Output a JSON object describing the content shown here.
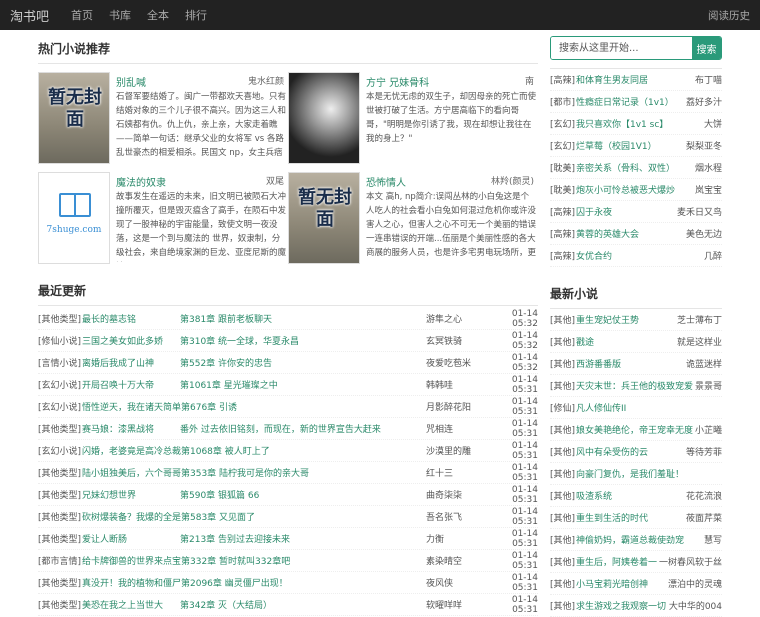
{
  "nav": {
    "brand": "淘书吧",
    "items": [
      "首页",
      "书库",
      "全本",
      "排行"
    ],
    "history": "阅读历史"
  },
  "hot": {
    "title": "热门小说推荐",
    "items": [
      {
        "title": "别乱喊",
        "author": "鬼水红颜",
        "cover": "placeholder",
        "cover_text": "暂无封面",
        "desc": "石督军要结婚了。闽广一带都欢天喜地。只有结婚对象的三个儿子很不高兴。因为这三人和石姨都有仇。仇上仇，亲上亲，大家走着瞧——简单一句话：继承父业的女将军 vs 各路乱世豪杰的相爱相杀。民国文 np，女主兵痞"
      },
      {
        "title": "方宁 兄妹骨科",
        "author": "南",
        "cover": "photo",
        "desc": "本是无忧无虑的双生子，却因母亲的死亡而使世被打破了生活。方宁居高临下的看向哥哥，\"明明是你引诱了我，现在却想让我往在我的身上？\""
      },
      {
        "title": "魔法的奴隶",
        "author": "双尾",
        "cover": "logo",
        "cover_text": "7shuge.com",
        "desc": "故事发生在遥远的未来，旧文明已被陨石大冲撞所覆灭，但是毁灭瘟含了高手，在陨石中发现了一股神秘的宇宙能量，致使文明一夜没落，这是一个到与魔法的 世界，奴隶制，分级社会，来自绝境家渊的巨龙、亚度尼斯的魔法"
      },
      {
        "title": "恐怖情人",
        "author": "林羚(颜灵)",
        "cover": "placeholder",
        "cover_text": "暂无封面",
        "desc": "本文 高h, np简介:误闯丛林的小白兔这是个人吃人的社会看小白兔如何混过危机你或许没害人之心，但害人之心不可无一个美丽的错误一连串错误的开端...伍丽是个美丽性感的各大商展的服务人员，也是许多宅男电玩场所，更"
      }
    ]
  },
  "updates": {
    "title": "最近更新",
    "rows": [
      {
        "cat": "[其他类型]",
        "book": "最长的墓志铭",
        "chapter": "第381章 跟前老板聊天",
        "author": "游隼之心",
        "time": "01-14 05:32"
      },
      {
        "cat": "[修仙小说]",
        "book": "三国之美女如此多娇",
        "chapter": "第310章 统一全球，华夏永昌",
        "author": "玄冥铁骑",
        "time": "01-14 05:32"
      },
      {
        "cat": "[言情小说]",
        "book": "离婚后我成了山神",
        "chapter": "第552章 许你安的忠告",
        "author": "夜爱吃苞米",
        "time": "01-14 05:32"
      },
      {
        "cat": "[玄幻小说]",
        "book": "开局召唤十万大帝",
        "chapter": "第1061章 星光璀璨之中",
        "author": "韩韩哇",
        "time": "01-14 05:31"
      },
      {
        "cat": "[玄幻小说]",
        "book": "悟性逆天，我在诸天简单第676章 引诱",
        "chapter": "",
        "author": "月影醉花阳",
        "time": "01-14 05:31"
      },
      {
        "cat": "[其他类型]",
        "book": "赛马娘：漆黑战将",
        "chapter": "番外 过去依旧铭刻，而现在，新的世界宣告大赶来",
        "author": "咒相连",
        "time": "01-14 05:31"
      },
      {
        "cat": "[玄幻小说]",
        "book": "闪婚，老婆竟是高冷总裁第1068章 被人盯上了",
        "chapter": "",
        "author": "沙漠里的雕",
        "time": "01-14 05:31"
      },
      {
        "cat": "[其他类型]",
        "book": "陆小姐独美后，六个哥哥第353章 陆柠我可是你的亲大哥",
        "chapter": "",
        "author": "红十三",
        "time": "01-14 05:31"
      },
      {
        "cat": "[其他类型]",
        "book": "兄妹幻想世界",
        "chapter": "第590章 银狐篇 66",
        "author": "曲奇柒柒",
        "time": "01-14 05:31"
      },
      {
        "cat": "[其他类型]",
        "book": "砍树爆装备？我爆的全是第583章 又见面了",
        "chapter": "",
        "author": "吾名张飞",
        "time": "01-14 05:31"
      },
      {
        "cat": "[其他类型]",
        "book": "爱让人断肠",
        "chapter": "第213章 告别过去迎接未来",
        "author": "力衡",
        "time": "01-14 05:31"
      },
      {
        "cat": "[都市言情]",
        "book": "给卡牌御兽的世界来点宝第332章 暂时就叫332章吧",
        "chapter": "",
        "author": "素染晴空",
        "time": "01-14 05:31"
      },
      {
        "cat": "[其他类型]",
        "book": "真没开！我的植物和僵尸第2096章 幽灵僵尸出现！",
        "chapter": "",
        "author": "夜风侠",
        "time": "01-14 05:31"
      },
      {
        "cat": "[其他类型]",
        "book": "美恐在我之上当世大",
        "chapter": "第342章 灭（大结局）",
        "author": "软曜咩咩",
        "time": "01-14 05:31"
      }
    ]
  },
  "search": {
    "placeholder": "搜索从这里开始...",
    "button": "搜索"
  },
  "side_top": {
    "rows": [
      {
        "cat": "[高辣]",
        "title": "和体育生男友同居",
        "author": "布丁喵"
      },
      {
        "cat": "[都市]",
        "title": "性瘾症日常记录（1v1）",
        "author": "荔好多汁"
      },
      {
        "cat": "[玄幻]",
        "title": "我只喜欢你【1v1 sc】",
        "author": "大饼"
      },
      {
        "cat": "[玄幻]",
        "title": "烂草莓（校园1V1）",
        "author": "梨梨亚冬"
      },
      {
        "cat": "[耽美]",
        "title": "亲密关系（骨科、双性）",
        "author": "烟水程"
      },
      {
        "cat": "[耽美]",
        "title": "炮灰小可怜总被恶犬爆炒",
        "author": "岚宝宝"
      },
      {
        "cat": "[高辣]",
        "title": "囚于永夜",
        "author": "麦禾日又鸟"
      },
      {
        "cat": "[高辣]",
        "title": "黄蓉的英雄大会",
        "author": "美色无边"
      },
      {
        "cat": "[高辣]",
        "title": "女优合约",
        "author": "几醉"
      }
    ]
  },
  "new_novels": {
    "title": "最新小说",
    "rows": [
      {
        "cat": "[其他]",
        "title": "重生宠妃仗王势",
        "author": "芝士薄布丁"
      },
      {
        "cat": "[其他]",
        "title": "戳途",
        "author": "就是这样业"
      },
      {
        "cat": "[其他]",
        "title": "西游番番版",
        "author": "诡蓝迷样"
      },
      {
        "cat": "[其他]",
        "title": "天灾末世：兵王他的极致宠爱",
        "author": "景景哥"
      },
      {
        "cat": "[修仙]",
        "title": "凡人修仙传II",
        "author": ""
      },
      {
        "cat": "[其他]",
        "title": "娘女美艳绝伦，帝王宠幸无度",
        "author": "小芷曦"
      },
      {
        "cat": "[其他]",
        "title": "风中有朵受伤的云",
        "author": "等待芳菲"
      },
      {
        "cat": "[其他]",
        "title": "向豪门复仇，是我们羞耻！",
        "author": ""
      },
      {
        "cat": "[其他]",
        "title": "吸渣系统",
        "author": "花花流浪"
      },
      {
        "cat": "[其他]",
        "title": "重生到生活的时代",
        "author": "莜面芹菜"
      },
      {
        "cat": "[其他]",
        "title": "神偷奶妈，霸道总裁使劲宠",
        "author": "慧写"
      },
      {
        "cat": "[其他]",
        "title": "重生后，阿姨卷着一",
        "author": "一树春风软于丝"
      },
      {
        "cat": "[其他]",
        "title": "小马宝莉光暗创神",
        "author": "漂泊中的灵魂"
      },
      {
        "cat": "[其他]",
        "title": "求生游戏之我观察一切",
        "author": "大中华的004"
      }
    ]
  }
}
